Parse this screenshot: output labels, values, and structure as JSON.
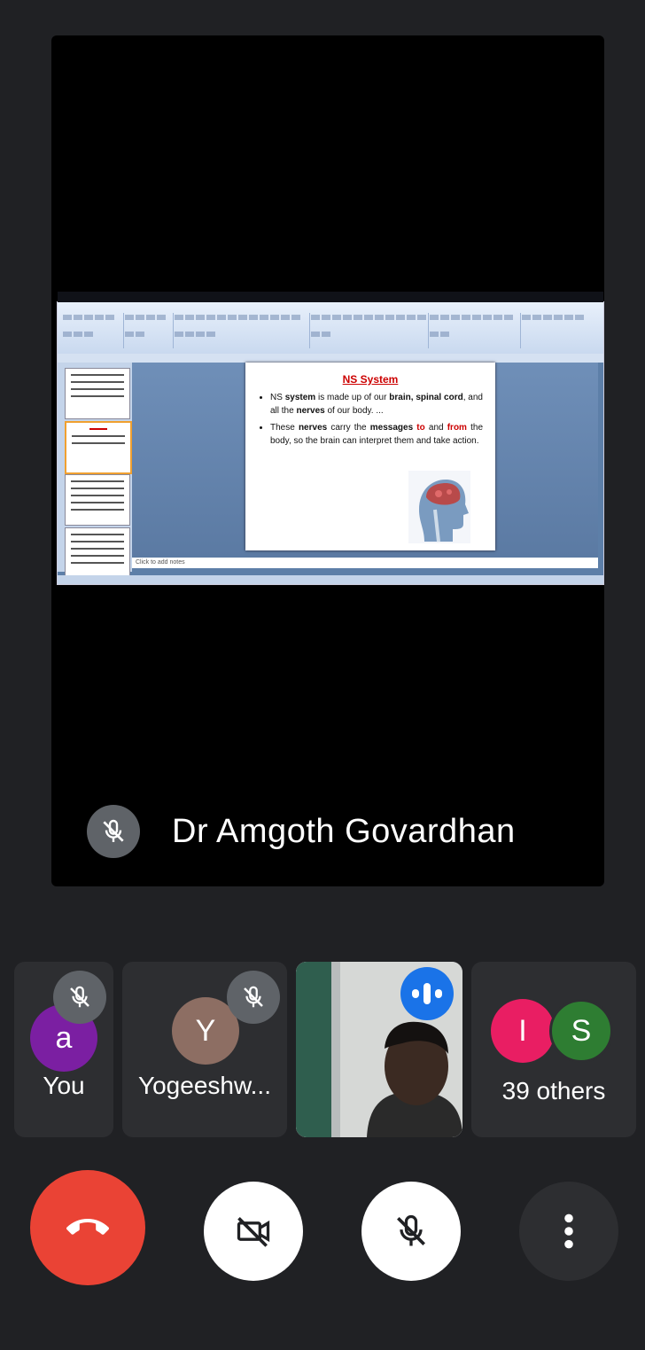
{
  "presenter": {
    "name": "Dr Amgoth Govardhan",
    "mic": "mic-off-icon"
  },
  "shared_screen": {
    "slide_title": "NS System",
    "bullet1": {
      "t1": "NS ",
      "b1": "system",
      "t2": " is made up of our ",
      "b2": "brain, spinal cord",
      "t3": ", and all the ",
      "b3": "nerves",
      "t4": " of our body. ..."
    },
    "bullet2": {
      "t1": "These ",
      "b1": "nerves",
      "t2": " carry the ",
      "b2": "messages",
      "r1": " to",
      "t3": " and ",
      "r2": "from",
      "t4": " the body, so the brain can interpret them and take action."
    },
    "notes_placeholder": "Click to add notes"
  },
  "participants": [
    {
      "label": "You",
      "initial": "a",
      "color": "#7b1fa2",
      "mic": "mic-off-icon"
    },
    {
      "label": "Yogeeshw...",
      "initial": "Y",
      "color": "#8d6e63",
      "mic": "mic-off-icon"
    },
    {
      "label": "",
      "video": true,
      "status": "speaking-icon"
    },
    {
      "label": "39 others",
      "initials": [
        "I",
        "S"
      ],
      "colors": [
        "#e91e63",
        "#2e7d32"
      ]
    }
  ],
  "controls": {
    "end_call": "call-end-icon",
    "camera": "camera-off-icon",
    "microphone": "mic-off-icon",
    "more": "more-vert-icon"
  },
  "colors": {
    "background": "#202124",
    "end_call_red": "#ea4335",
    "speaking_blue": "#1a73e8"
  }
}
